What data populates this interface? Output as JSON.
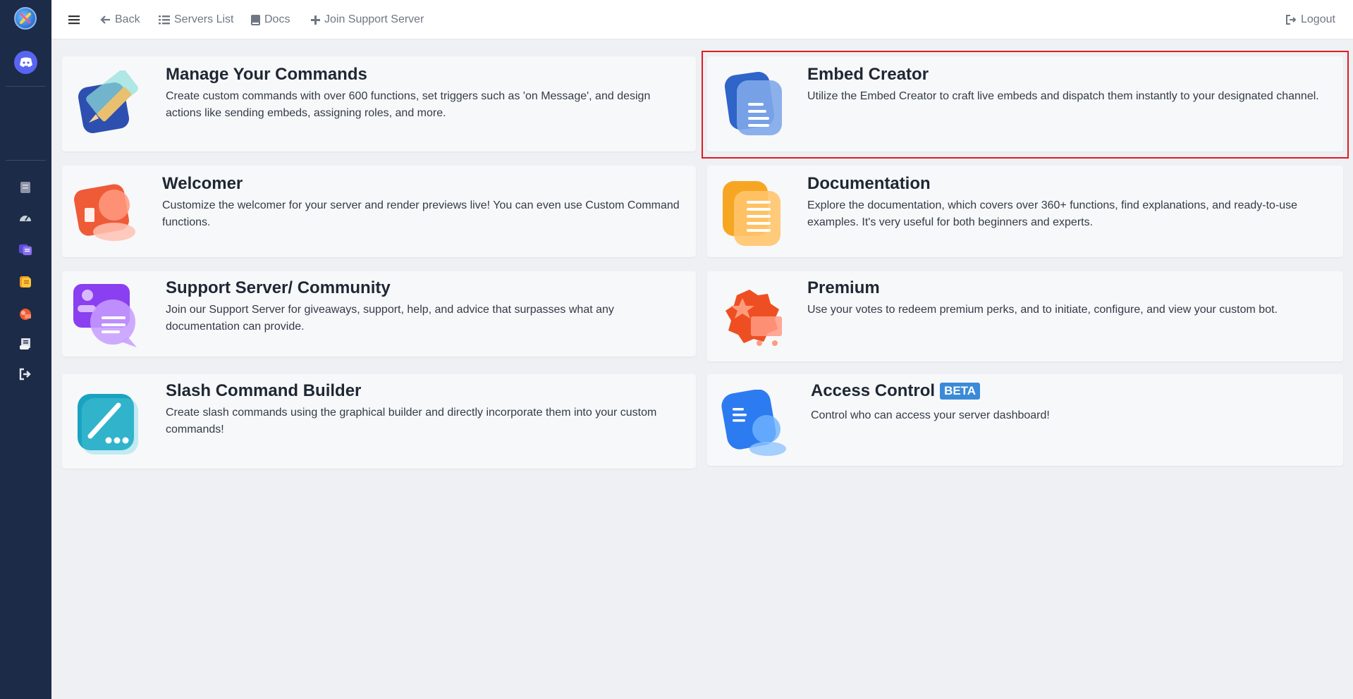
{
  "nav": {
    "back": "Back",
    "servers_list": "Servers List",
    "docs": "Docs",
    "join_support": "Join Support Server",
    "logout": "Logout"
  },
  "sidebar": {
    "icons": [
      "app-logo-icon",
      "discord-icon",
      "commands-icon",
      "dashboard-icon",
      "embed-icon",
      "docs-icon",
      "premium-icon",
      "scroll-icon",
      "logout-icon"
    ]
  },
  "cards": {
    "manage": {
      "title": "Manage Your Commands",
      "desc": "Create custom commands with over 600 functions, set triggers such as 'on Message', and design actions like sending embeds, assigning roles, and more."
    },
    "embed": {
      "title": "Embed Creator",
      "desc": "Utilize the Embed Creator to craft live embeds and dispatch them instantly to your designated channel."
    },
    "welcomer": {
      "title": "Welcomer",
      "desc": "Customize the welcomer for your server and render previews live! You can even use Custom Command functions."
    },
    "documentation": {
      "title": "Documentation",
      "desc": "Explore the documentation, which covers over 360+ functions, find explanations, and ready-to-use examples. It's very useful for both beginners and experts."
    },
    "support": {
      "title": "Support Server/ Community",
      "desc": "Join our Support Server for giveaways, support, help, and advice that surpasses what any documentation can provide."
    },
    "premium": {
      "title": "Premium",
      "desc": "Use your votes to redeem premium perks, and to initiate, configure, and view your custom bot."
    },
    "slash": {
      "title": "Slash Command Builder",
      "desc": "Create slash commands using the graphical builder and directly incorporate them into your custom commands!"
    },
    "access": {
      "title": "Access Control",
      "badge": "BETA",
      "desc": "Control who can access your server dashboard!"
    }
  },
  "colors": {
    "sidebar": "#1c2b47",
    "highlight": "#e01b24",
    "badge": "#3b8ad8"
  }
}
